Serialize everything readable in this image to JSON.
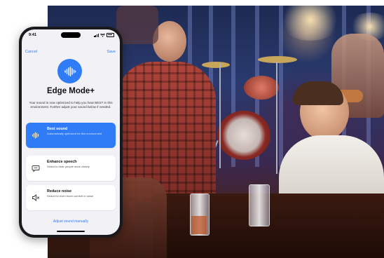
{
  "status_bar": {
    "time": "9:41"
  },
  "nav": {
    "cancel_label": "Cancel",
    "save_label": "Save"
  },
  "app": {
    "logo_icon": "waveform-icon",
    "title": "Edge Mode+",
    "description": "Your sound is now optimized to help you hear BEST in this environment. Further adjust your sound below if needed."
  },
  "options": [
    {
      "title": "Best sound",
      "description": "Automatically optimized for this environment",
      "icon": "waveform-icon",
      "selected": true
    },
    {
      "title": "Enhance speech",
      "description": "Select to hear people more clearly",
      "icon": "speech-bubble-icon",
      "selected": false
    },
    {
      "title": "Reduce noise",
      "description": "Select for even more comfort in noise",
      "icon": "speaker-icon",
      "selected": false
    }
  ],
  "footer": {
    "adjust_link": "Adjust sound manually"
  },
  "colors": {
    "accent": "#2f7cf6",
    "screen_bg": "#f2f2f6",
    "phone_frame": "#1a1a1c"
  }
}
